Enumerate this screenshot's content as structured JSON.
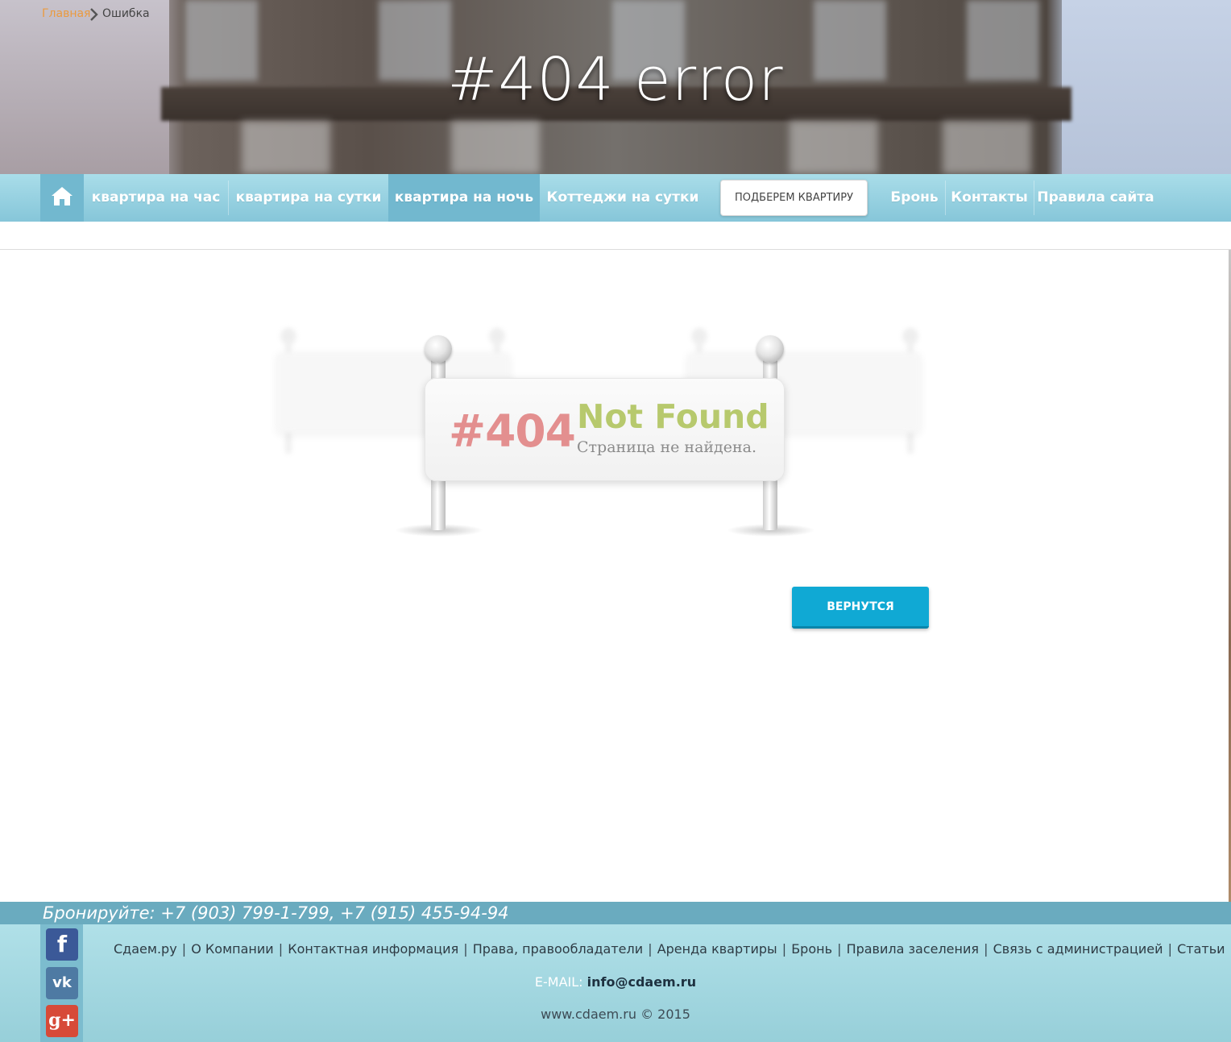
{
  "hero": {
    "title": "#404 error"
  },
  "nav": {
    "home_icon": "home-icon",
    "items": [
      {
        "label": "квартира на час"
      },
      {
        "label": "квартира на сутки"
      },
      {
        "label": "квартира на ночь",
        "active": true
      },
      {
        "label": "Коттеджи на сутки"
      },
      {
        "label": "Бронь"
      },
      {
        "label": "Контакты"
      },
      {
        "label": "Правила сайта"
      }
    ],
    "pick_button": "ПОДБЕРЕМ КВАРТИРУ"
  },
  "breadcrumb": {
    "home": "Главная",
    "current": "Ошибка",
    "separator_icon": "chevron-right-icon"
  },
  "sign": {
    "code": "#404",
    "title": "Not Found",
    "subtitle": "Страница не найдена."
  },
  "back_button": "ВЕРНУТСЯ",
  "footer": {
    "phone_line": "Бронируйте: +7 (903) 799-1-799, +7 (915) 455-94-94",
    "social": [
      "facebook-icon",
      "vk-icon",
      "google-plus-icon"
    ],
    "links": [
      "Сдаем.ру",
      "О Компании",
      "Контактная информация",
      "Права, правообладатели",
      "Аренда квартиры",
      "Бронь",
      "Правила заселения",
      "Связь с администрацией",
      "Статьи"
    ],
    "email_label": "E-MAIL:",
    "email": "info@cdaem.ru",
    "copyright": "www.cdaem.ru © 2015"
  },
  "colors": {
    "nav_bg": "#9fd6e3",
    "nav_active": "#72b8cf",
    "breadcrumb_link": "#eb9a3f",
    "code_red": "#e38f8f",
    "title_green": "#b7c96d",
    "button_blue": "#10a9d4",
    "footer_bar": "#6aabbf"
  }
}
